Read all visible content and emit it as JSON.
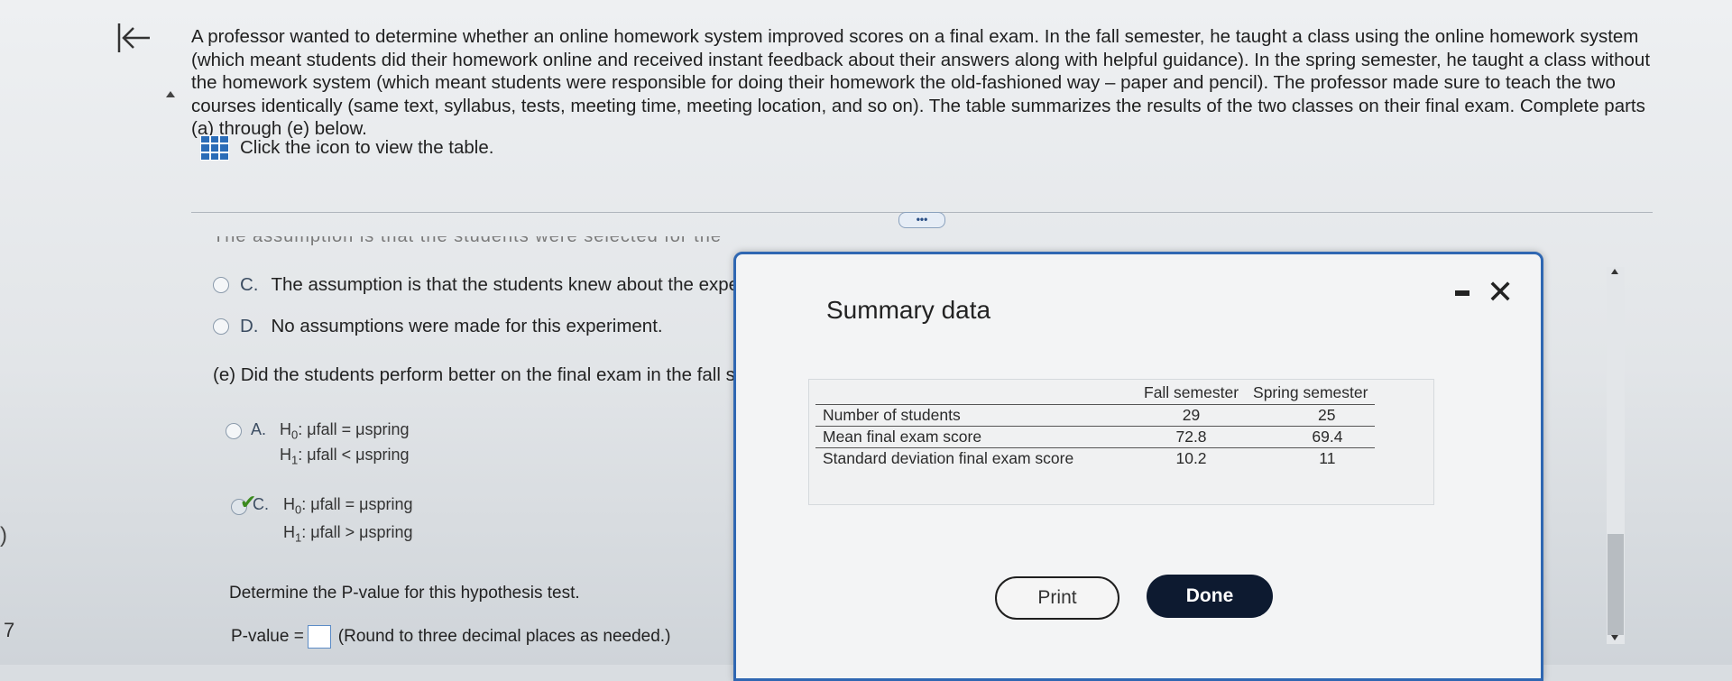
{
  "question": {
    "text": "A professor wanted to determine whether an online homework system improved scores on a final exam. In the fall semester, he taught a class using the online homework system (which meant students did their homework online and received instant feedback about their answers along with helpful guidance). In the spring semester, he taught a class without the homework system (which meant students were responsible for doing their homework the old-fashioned way – paper and pencil). The professor made sure to teach the two courses identically (same text, syllabus, tests, meeting time, meeting location, and so on). The table summarizes the results of the two classes on their final exam. Complete parts (a) through (e) below.",
    "table_link": "Click the icon to view the table.",
    "more_label": "•••"
  },
  "options_prev": {
    "cut_text": "The assumption is that the students were selected for the",
    "C": {
      "letter": "C.",
      "text": "The assumption is that the students knew about the expe"
    },
    "D": {
      "letter": "D.",
      "text": "No assumptions were made for this experiment."
    }
  },
  "part_e": {
    "prompt": "(e) Did the students perform better on the final exam in the fall se",
    "A": {
      "letter": "A.",
      "h0": "μfall = μspring",
      "h1": "μfall < μspring"
    },
    "C": {
      "letter": "C.",
      "h0": "μfall = μspring",
      "h1": "μfall > μspring",
      "selected": true
    },
    "determine": "Determine the P-value for this hypothesis test.",
    "pvalue_label": "P-value =",
    "pvalue_hint": "(Round to three decimal places as needed.)"
  },
  "edge": {
    "brace": ")",
    "seven": "7"
  },
  "popup": {
    "title": "Summary data",
    "columns": [
      "",
      "Fall semester",
      "Spring semester"
    ],
    "rows": [
      {
        "label": "Number of students",
        "fall": "29",
        "spring": "25"
      },
      {
        "label": "Mean final exam score",
        "fall": "72.8",
        "spring": "69.4"
      },
      {
        "label": "Standard deviation final exam score",
        "fall": "10.2",
        "spring": "11"
      }
    ],
    "print_label": "Print",
    "done_label": "Done",
    "close_label": "✕"
  }
}
